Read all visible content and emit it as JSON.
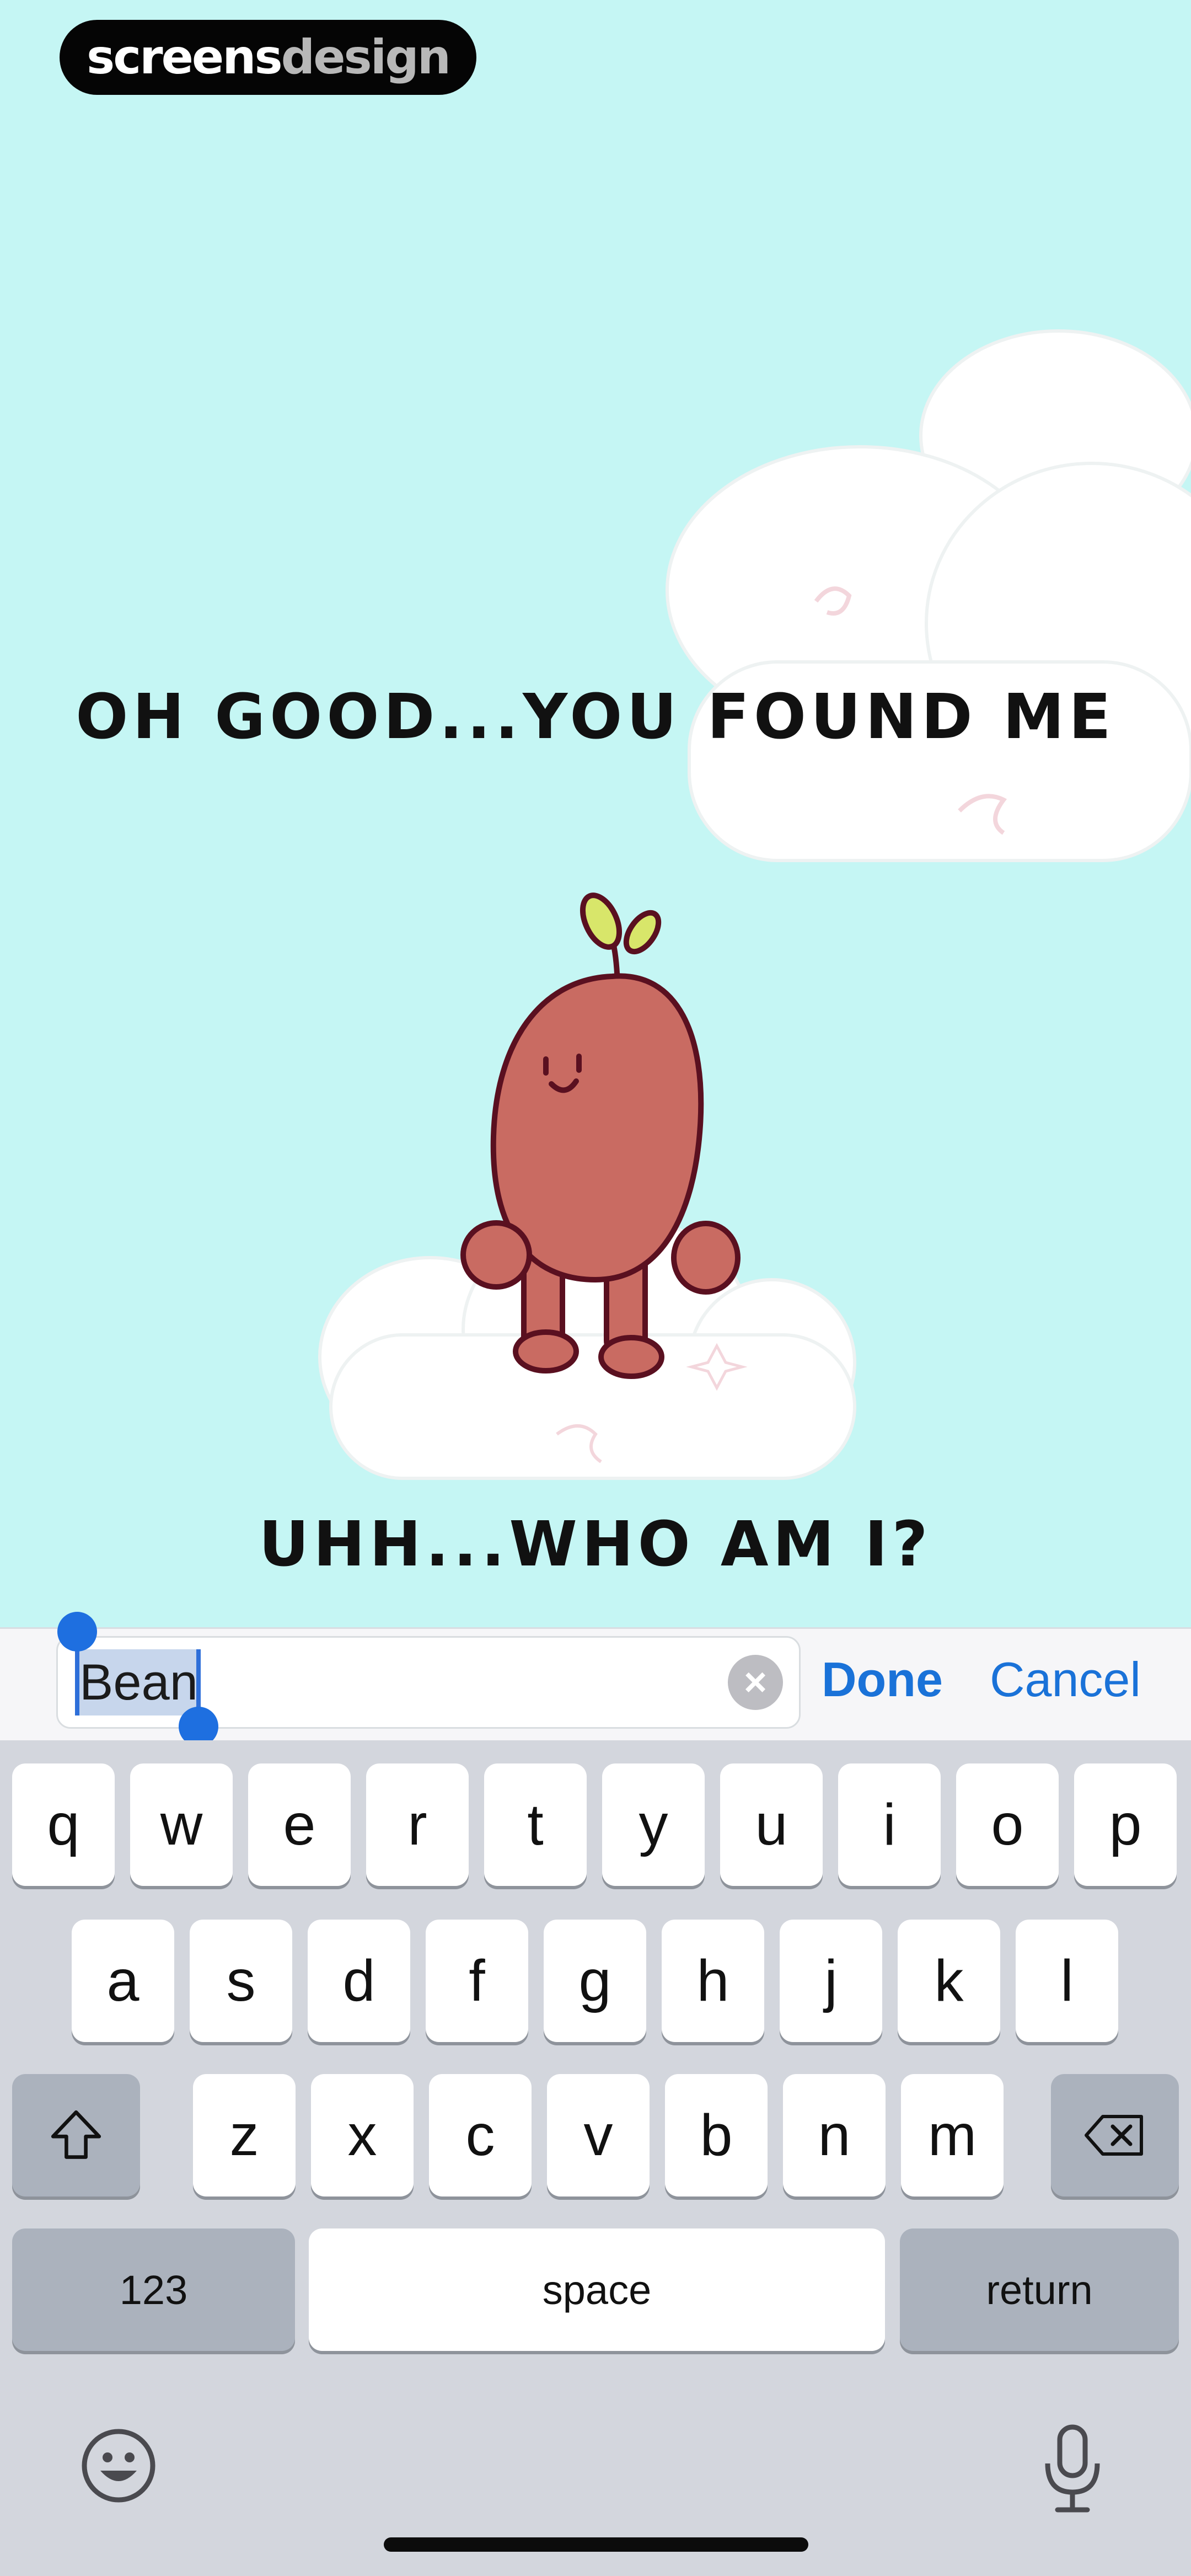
{
  "watermark": {
    "part1": "screens",
    "part2": "design"
  },
  "headline_top": "OH GOOD...YOU FOUND ME",
  "headline_bottom": "UHH...WHO AM I?",
  "search": {
    "value": "Bean",
    "done_label": "Done",
    "cancel_label": "Cancel"
  },
  "keyboard": {
    "row1": [
      "q",
      "w",
      "e",
      "r",
      "t",
      "y",
      "u",
      "i",
      "o",
      "p"
    ],
    "row2": [
      "a",
      "s",
      "d",
      "f",
      "g",
      "h",
      "j",
      "k",
      "l"
    ],
    "row3": [
      "z",
      "x",
      "c",
      "v",
      "b",
      "n",
      "m"
    ],
    "numbers_label": "123",
    "space_label": "space",
    "return_label": "return"
  },
  "icons": [
    "shift-icon",
    "backspace-icon",
    "emoji-icon",
    "microphone-icon",
    "clear-icon"
  ],
  "colors": {
    "background": "#c5f6f4",
    "accent": "#1a72d8",
    "bean": "#c96b62"
  }
}
